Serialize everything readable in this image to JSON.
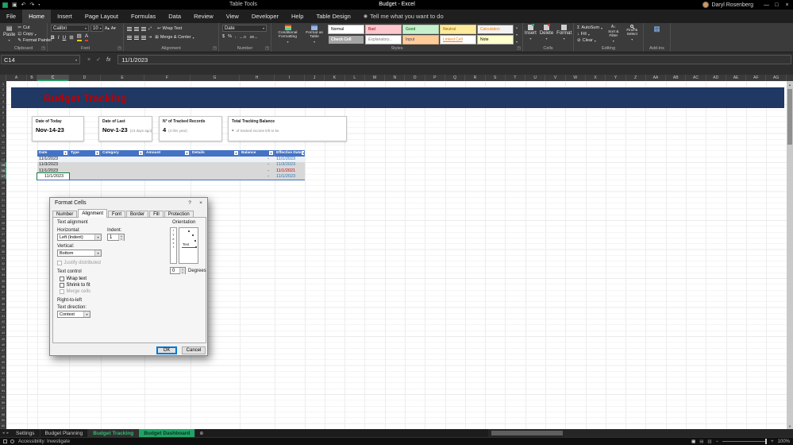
{
  "icons": {
    "dropdown": "▾",
    "close": "×",
    "minimize": "—",
    "maximize": "□",
    "help": "?",
    "save": "▣",
    "undo": "↶",
    "redo": "↷",
    "scissors": "✂",
    "copy": "⊡",
    "brush": "✎",
    "paste": "▤",
    "borders": "⊞",
    "fill_color": "▨",
    "wrap": "↩",
    "merge": "⊞",
    "currency": "$",
    "percent": "%",
    "comma": ",",
    "inc_decimal": "←.0",
    "dec_decimal": ".00→",
    "sigma": "Σ",
    "fill_down": "↓",
    "eraser": "⊘",
    "sort": "A↓",
    "check": "✓",
    "tell_me": "◉",
    "launcher": "◳",
    "gallery_up": "▴",
    "gallery_down": "▾",
    "scroll_up": "▲",
    "scroll_down": "▼",
    "nav_left": "◂",
    "nav_right": "▸",
    "add_sheet": "⊕",
    "filter": "▾",
    "view_normal": "▦",
    "view_layout": "▤",
    "view_break": "▥",
    "zoom_out": "−",
    "zoom_in": "+",
    "grow_font": "A▴",
    "shrink_font": "A▾",
    "font_color_letter": "A",
    "wrap_ab": "ab"
  },
  "title_bar": {
    "title": "Budget - Excel",
    "context_label": "Table Tools",
    "user_name": "Daryl Rosenberg"
  },
  "ribbon_tabs": [
    {
      "label": "File"
    },
    {
      "label": "Home",
      "active": true
    },
    {
      "label": "Insert"
    },
    {
      "label": "Page Layout"
    },
    {
      "label": "Formulas"
    },
    {
      "label": "Data"
    },
    {
      "label": "Review"
    },
    {
      "label": "View"
    },
    {
      "label": "Developer"
    },
    {
      "label": "Help"
    },
    {
      "label": "Table Design",
      "contextual": true
    }
  ],
  "tell_me": "Tell me what you want to do",
  "ribbon": {
    "clipboard": {
      "label": "Clipboard",
      "paste": "Paste",
      "cut": "Cut",
      "copy": "Copy",
      "format_painter": "Format Painter"
    },
    "font": {
      "label": "Font",
      "family": "Calibri",
      "size": "10",
      "bold": "B",
      "italic": "I",
      "underline": "U"
    },
    "alignment": {
      "label": "Alignment",
      "wrap_text": "Wrap Text",
      "merge_center": "Merge & Center"
    },
    "number": {
      "label": "Number",
      "format": "Date"
    },
    "styles": {
      "label": "Styles",
      "conditional": "Conditional Formatting",
      "format_table": "Format as Table",
      "gallery": [
        {
          "label": "Normal",
          "bg": "#FFFFFF",
          "fg": "#000000",
          "border": "#ABABAB"
        },
        {
          "label": "Bad",
          "bg": "#FFC7CE",
          "fg": "#9C0006"
        },
        {
          "label": "Good",
          "bg": "#C6EFCE",
          "fg": "#006100"
        },
        {
          "label": "Neutral",
          "bg": "#FFEB9C",
          "fg": "#9C6500"
        },
        {
          "label": "Calculation",
          "bg": "#F2F2F2",
          "fg": "#FA7D00",
          "border": "#7F7F7F"
        },
        {
          "label": "Check Cell",
          "bg": "#A5A5A5",
          "fg": "#FFFFFF",
          "border": "#3F3F3F",
          "bold": true
        },
        {
          "label": "Explanatory...",
          "bg": "#FFFFFF",
          "fg": "#7F7F7F",
          "italic": true,
          "border": "#ABABAB"
        },
        {
          "label": "Input",
          "bg": "#FFCC99",
          "fg": "#3F3F76"
        },
        {
          "label": "Linked Cell",
          "bg": "#FFFFFF",
          "fg": "#FA7D00",
          "underline": true,
          "border": "#ABABAB"
        },
        {
          "label": "Note",
          "bg": "#FFFFCC",
          "fg": "#000000",
          "border": "#B2B2B2"
        }
      ]
    },
    "cells": {
      "label": "Cells",
      "insert": "Insert",
      "delete": "Delete",
      "format": "Format"
    },
    "editing": {
      "label": "Editing",
      "autosum": "AutoSum",
      "fill": "Fill",
      "clear": "Clear",
      "sort_filter": "Sort & Filter",
      "find_select": "Find & Select"
    },
    "addins": {
      "label": "Add-ins"
    }
  },
  "formula_bar": {
    "name_box": "C14",
    "fx": "fx",
    "value": "11/1/2023"
  },
  "grid": {
    "columns": [
      "A",
      "B",
      "C",
      "D",
      "E",
      "F",
      "G",
      "H",
      "I",
      "J",
      "K",
      "L",
      "M",
      "N",
      "O",
      "P",
      "Q",
      "R",
      "S",
      "T",
      "U",
      "V",
      "W",
      "X",
      "Y",
      "Z",
      "AA",
      "AB",
      "AC",
      "AD",
      "AE",
      "AF",
      "AG"
    ],
    "selected_column": "C",
    "row_count": 60,
    "selected_rows": [
      15,
      16,
      17
    ]
  },
  "sheet": {
    "banner_title": "Budget Tracking",
    "cards": [
      {
        "label": "Date of Today",
        "value": "Nov-14-23",
        "note": ""
      },
      {
        "label": "Date of Last",
        "value": "Nov-1-23",
        "note": "(13 days ago)"
      },
      {
        "label": "N° of Tracked Records",
        "value": "4",
        "note": "(4 this year)"
      },
      {
        "label": "Total Tracking Balance",
        "value": "-",
        "note": "of tracked income left to be"
      }
    ],
    "table": {
      "headers": [
        "Date",
        "Type",
        "Category",
        "Amount",
        "Details",
        "Balance",
        "Effective Date"
      ],
      "rows": [
        {
          "date": "11/1/2023",
          "balance": "-",
          "effective": "11/1/2023",
          "effective_color": "#2E75B6",
          "selected": false,
          "active": false,
          "indent": false
        },
        {
          "date": "11/3/2023",
          "balance": "-",
          "effective": "11/3/2023",
          "effective_color": "#2E75B6",
          "selected": true,
          "active": false,
          "indent": false
        },
        {
          "date": "11/1/2023",
          "balance": "-",
          "effective": "11/1/2021",
          "effective_color": "#C00000",
          "selected": true,
          "active": false,
          "indent": false
        },
        {
          "date": "11/1/2023",
          "balance": "-",
          "effective": "11/1/2023",
          "effective_color": "#2E75B6",
          "selected": true,
          "active": true,
          "indent": true
        }
      ]
    }
  },
  "dialog": {
    "title": "Format Cells",
    "tabs": [
      "Number",
      "Alignment",
      "Font",
      "Border",
      "Fill",
      "Protection"
    ],
    "active_tab": "Alignment",
    "sections": {
      "text_alignment": "Text alignment",
      "horizontal_label": "Horizontal:",
      "horizontal_value": "Left (Indent)",
      "indent_label": "Indent:",
      "indent_value": "1",
      "vertical_label": "Vertical:",
      "vertical_value": "Bottom",
      "justify_distributed": "Justify distributed",
      "text_control": "Text control",
      "wrap_text": "Wrap text",
      "shrink_to_fit": "Shrink to fit",
      "merge_cells": "Merge cells",
      "right_to_left": "Right-to-left",
      "text_direction_label": "Text direction:",
      "text_direction_value": "Context",
      "orientation": "Orientation",
      "orientation_text": "Text",
      "degrees_value": "0",
      "degrees_label": "Degrees"
    },
    "ok": "OK",
    "cancel": "Cancel"
  },
  "sheet_tabs": [
    {
      "label": "Settings"
    },
    {
      "label": "Budget Planning"
    },
    {
      "label": "Budget Tracking",
      "active": true
    },
    {
      "label": "Budget Dashboard",
      "colored": true
    }
  ],
  "status_bar": {
    "left": "Accessibility: Investigate",
    "zoom": "100%"
  }
}
